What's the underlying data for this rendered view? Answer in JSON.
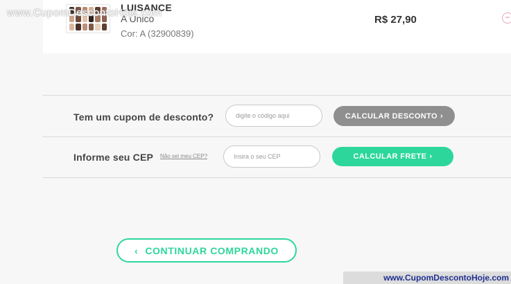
{
  "watermark": {
    "top_text": "www.CupomDescontoHoje.com",
    "bottom_text": "www.CupomDescontoHoje.com"
  },
  "product": {
    "brand": "LUISANCE",
    "variant": "A Único",
    "color": "Cor: A (32900839)",
    "price": "R$ 27,90",
    "remove_symbol": "−",
    "palette_colors": [
      "#3a2a24",
      "#7a5446",
      "#b98a72",
      "#d4b39a",
      "#5a3b30",
      "#9b6b5a",
      "#c9a48a",
      "#6e4a3c",
      "#e0c2aa",
      "#2f211c",
      "#a87a66",
      "#8a6050",
      "#d9b8a0",
      "#4b3129",
      "#bb917b",
      "#7f5a4b",
      "#e8d1bd",
      "#5f3f33"
    ]
  },
  "coupon": {
    "label": "Tem um cupom de desconto?",
    "input_placeholder": "digite o código aqui",
    "button_label": "CALCULAR DESCONTO",
    "button_chevron": "›"
  },
  "shipping": {
    "label": "Informe seu CEP",
    "help_link": "Não sei meu CEP?",
    "input_placeholder": "Insira o seu CEP",
    "button_label": "CALCULAR FRETE",
    "button_chevron": "›"
  },
  "continue": {
    "chevron": "‹",
    "label": "CONTINUAR COMPRANDO"
  },
  "colors": {
    "accent": "#2dd79b",
    "coupon_button": "#8f8f8f",
    "remove_icon": "#d9788f"
  }
}
